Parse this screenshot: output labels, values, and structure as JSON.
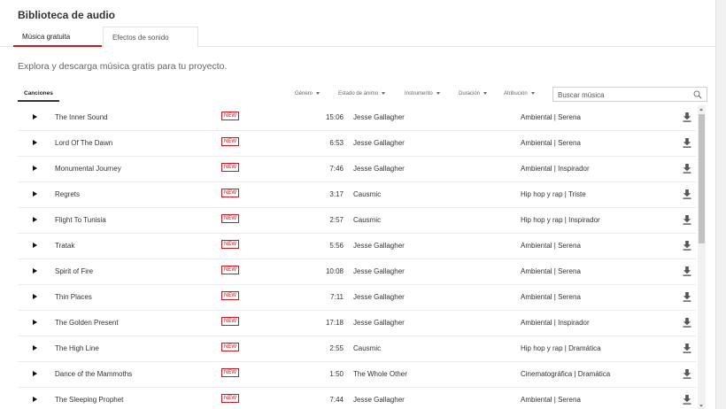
{
  "app_title": "Biblioteca de audio",
  "tabs": [
    {
      "label": "Música gratuita",
      "active": true
    },
    {
      "label": "Efectos de sonido",
      "active": false
    }
  ],
  "subtitle": "Explora y descarga música gratis para tu proyecto.",
  "songs_tab": "Canciones",
  "filters": {
    "genre": "Género",
    "mood": "Estado de ánimo",
    "instrument": "Instrumento",
    "duration": "Duración",
    "attribution": "Atribución"
  },
  "search": {
    "placeholder": "Buscar música",
    "value": ""
  },
  "icons": {
    "play": "play-icon",
    "download": "download-icon",
    "search": "search-icon"
  },
  "colors": {
    "accent": "#cc181e"
  },
  "tracks": [
    {
      "title": "The Inner Sound",
      "badge": "NEW",
      "duration": "15:06",
      "artist": "Jesse Gallagher",
      "genre_mood": "Ambiental | Serena"
    },
    {
      "title": "Lord Of The Dawn",
      "badge": "NEW",
      "duration": "6:53",
      "artist": "Jesse Gallagher",
      "genre_mood": "Ambiental | Serena"
    },
    {
      "title": "Monumental Journey",
      "badge": "NEW",
      "duration": "7:46",
      "artist": "Jesse Gallagher",
      "genre_mood": "Ambiental | Inspirador"
    },
    {
      "title": "Regrets",
      "badge": "NEW",
      "duration": "3:17",
      "artist": "Causmic",
      "genre_mood": "Hip hop y rap | Triste"
    },
    {
      "title": "Flight To Tunisia",
      "badge": "NEW",
      "duration": "2:57",
      "artist": "Causmic",
      "genre_mood": "Hip hop y rap | Inspirador"
    },
    {
      "title": "Tratak",
      "badge": "NEW",
      "duration": "5:56",
      "artist": "Jesse Gallagher",
      "genre_mood": "Ambiental | Serena"
    },
    {
      "title": "Spirit of Fire",
      "badge": "NEW",
      "duration": "10:08",
      "artist": "Jesse Gallagher",
      "genre_mood": "Ambiental | Serena"
    },
    {
      "title": "Thin Places",
      "badge": "NEW",
      "duration": "7:11",
      "artist": "Jesse Gallagher",
      "genre_mood": "Ambiental | Serena"
    },
    {
      "title": "The Golden Present",
      "badge": "NEW",
      "duration": "17:18",
      "artist": "Jesse Gallagher",
      "genre_mood": "Ambiental | Inspirador"
    },
    {
      "title": "The High Line",
      "badge": "NEW",
      "duration": "2:55",
      "artist": "Causmic",
      "genre_mood": "Hip hop y rap | Dramática"
    },
    {
      "title": "Dance of the Mammoths",
      "badge": "NEW",
      "duration": "1:50",
      "artist": "The Whole Other",
      "genre_mood": "Cinematográfica | Dramática"
    },
    {
      "title": "The Sleeping Prophet",
      "badge": "NEW",
      "duration": "7:44",
      "artist": "Jesse Gallagher",
      "genre_mood": "Ambiental | Serena"
    }
  ]
}
